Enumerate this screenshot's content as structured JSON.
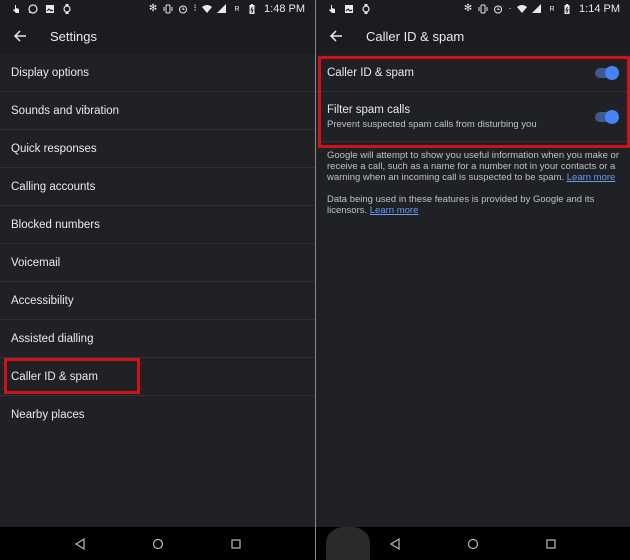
{
  "left": {
    "status": {
      "icons_left": [
        "touch-icon",
        "whatsapp-icon",
        "image-icon",
        "watch-icon"
      ],
      "icons_right": [
        "bluetooth-icon",
        "vibrate-icon",
        "alarm-icon",
        "data-arrows-icon",
        "wifi-icon",
        "signal-icon",
        "roaming-icon",
        "battery-charging-icon"
      ],
      "roaming": "R",
      "time": "1:48 PM"
    },
    "appbar": {
      "title": "Settings",
      "back_icon": "arrow-left-icon"
    },
    "items": [
      {
        "label": "Display options"
      },
      {
        "label": "Sounds and vibration"
      },
      {
        "label": "Quick responses"
      },
      {
        "label": "Calling accounts"
      },
      {
        "label": "Blocked numbers"
      },
      {
        "label": "Voicemail"
      },
      {
        "label": "Accessibility"
      },
      {
        "label": "Assisted dialling"
      },
      {
        "label": "Caller ID & spam",
        "highlighted": true
      },
      {
        "label": "Nearby places"
      }
    ],
    "highlight_color": "#d0101a"
  },
  "right": {
    "status": {
      "icons_left": [
        "touch-icon",
        "image-icon",
        "watch-icon"
      ],
      "icons_right": [
        "bluetooth-icon",
        "vibrate-icon",
        "alarm-icon",
        "data-arrows-icon",
        "wifi-icon",
        "signal-icon",
        "roaming-icon",
        "battery-charging-icon"
      ],
      "roaming": "R",
      "time": "1:14 PM"
    },
    "appbar": {
      "title": "Caller ID & spam",
      "back_icon": "arrow-left-icon"
    },
    "toggles": [
      {
        "title": "Caller ID & spam",
        "subtitle": null,
        "on": true
      },
      {
        "title": "Filter spam calls",
        "subtitle": "Prevent suspected spam calls from disturbing you",
        "on": true
      }
    ],
    "info": [
      {
        "text": "Google will attempt to show you useful information when you make or receive a call, such as a name for a number not in your contacts or a warning when an incoming call is suspected to be spam. ",
        "link": "Learn more"
      },
      {
        "text": "Data being used in these features is provided by Google and its licensors. ",
        "link": "Learn more"
      }
    ],
    "accent_color": "#4285f4",
    "link_color": "#669df6"
  },
  "navbar": {
    "buttons": [
      "back-nav-icon",
      "home-nav-icon",
      "recents-nav-icon"
    ]
  }
}
